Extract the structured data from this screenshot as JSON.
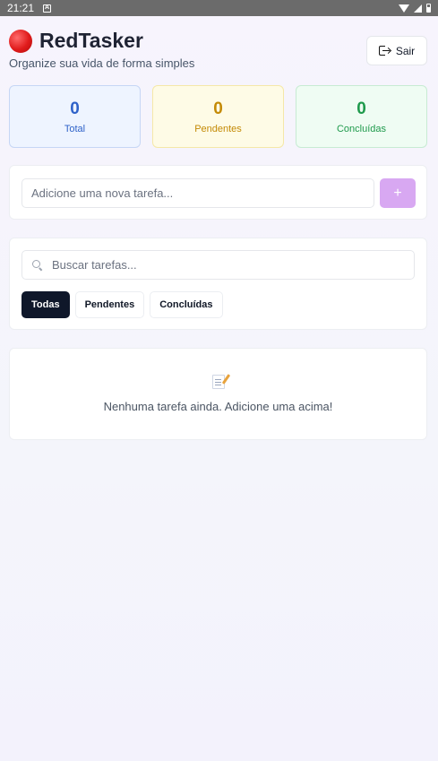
{
  "status_bar": {
    "time": "21:21"
  },
  "header": {
    "title": "RedTasker",
    "subtitle": "Organize sua vida de forma simples",
    "logout_label": "Sair"
  },
  "stats": [
    {
      "value": "0",
      "label": "Total"
    },
    {
      "value": "0",
      "label": "Pendentes"
    },
    {
      "value": "0",
      "label": "Concluídas"
    }
  ],
  "add_task": {
    "placeholder": "Adicione uma nova tarefa...",
    "button": "+"
  },
  "search": {
    "placeholder": "Buscar tarefas..."
  },
  "filters": [
    {
      "label": "Todas",
      "active": true
    },
    {
      "label": "Pendentes",
      "active": false
    },
    {
      "label": "Concluídas",
      "active": false
    }
  ],
  "empty_state": {
    "icon": "memo-icon",
    "message": "Nenhuma tarefa ainda. Adicione uma acima!"
  },
  "colors": {
    "accent_button": "#d8a8f2",
    "active_filter": "#0f172a",
    "total": "#2f62c9",
    "pending": "#c48a06",
    "done": "#1f9a4c"
  }
}
